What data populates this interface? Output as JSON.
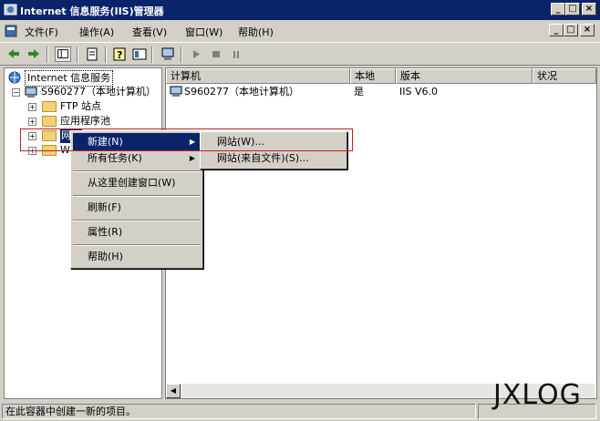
{
  "window": {
    "title": "Internet 信息服务(IIS)管理器"
  },
  "caption_buttons": {
    "minimize": "_",
    "maximize": "□",
    "close": "×"
  },
  "menubar": {
    "items": [
      {
        "label": "文件(F)"
      },
      {
        "label": "操作(A)"
      },
      {
        "label": "查看(V)"
      },
      {
        "label": "窗口(W)"
      },
      {
        "label": "帮助(H)"
      }
    ]
  },
  "tree": {
    "root": "Internet 信息服务",
    "server": "S960277（本地计算机）",
    "children": [
      "FTP 站点",
      "应用程序池",
      "网站",
      "Web"
    ]
  },
  "list": {
    "columns": [
      "计算机",
      "本地",
      "版本",
      "状况"
    ],
    "rows": [
      {
        "computer": "S960277（本地计算机）",
        "local": "是",
        "version": "IIS V6.0",
        "status": ""
      }
    ]
  },
  "context_menu": {
    "items": [
      "新建(N)",
      "所有任务(K)",
      "从这里创建窗口(W)",
      "刷新(F)",
      "属性(R)",
      "帮助(H)"
    ]
  },
  "submenu": {
    "items": [
      "网站(W)...",
      "网站(来自文件)(S)..."
    ]
  },
  "statusbar": {
    "text": "在此容器中创建一新的项目。"
  },
  "watermark": "JXLOG",
  "colors": {
    "title_bar": "#0a246a",
    "highlight": "#0a246a",
    "face": "#d4d0c8",
    "annotation_box": "#c02020"
  },
  "icons": [
    "iis-app-icon",
    "back-icon",
    "forward-icon",
    "show-tree-icon",
    "export-icon",
    "help-icon",
    "console-icon",
    "computer-icon",
    "play-icon",
    "stop-icon",
    "pause-icon",
    "folder-icon"
  ]
}
